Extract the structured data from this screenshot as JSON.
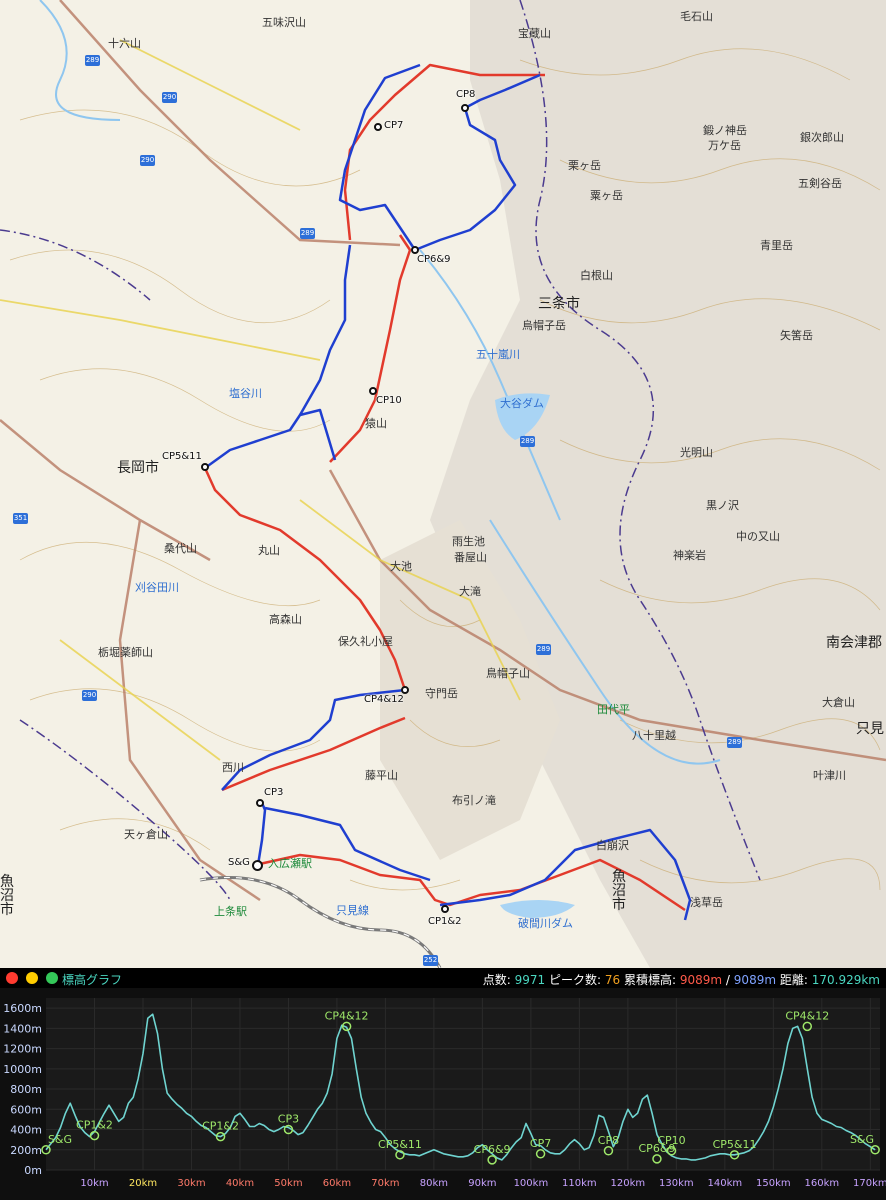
{
  "map": {
    "cities": [
      "三条市",
      "長岡市",
      "魚沼市",
      "南会津郡",
      "只見"
    ],
    "mountains": [
      "五味沢山",
      "粟ヶ岳",
      "宝蔵山",
      "毛石山",
      "銀次郎山",
      "五剣谷岳",
      "青里岳",
      "白根山",
      "烏帽子岳",
      "光明山",
      "矢筈岳",
      "猿山",
      "丸山",
      "守門岳",
      "鳥帽子山",
      "大倉山",
      "中の又山",
      "桑代山",
      "刈谷田川",
      "高森山",
      "栃堀薬師山",
      "西川",
      "天ヶ倉山",
      "藤平山",
      "布引ノ滝",
      "白崩沢",
      "浅草岳",
      "神楽岩",
      "叶津川",
      "鍛ノ神岳",
      "万ケ岳",
      "田代平",
      "八十里越",
      "五十嵐川",
      "栗ヶ岳",
      "黒ノ沢",
      "大池",
      "雨生池",
      "番屋山",
      "大滝",
      "保久礼小屋",
      "十六山",
      "塩谷川"
    ],
    "water": [
      "大谷ダム",
      "破間川ダム",
      "只見線"
    ],
    "stations": [
      "上条駅",
      "入広瀬駅"
    ],
    "road_numbers": [
      "289",
      "290",
      "351",
      "252"
    ],
    "checkpoints": [
      "CP8",
      "CP7",
      "CP6&9",
      "CP10",
      "CP5&11",
      "CP4&12",
      "CP3",
      "S&G",
      "CP1&2"
    ]
  },
  "graph": {
    "title": "標高グラフ",
    "stats": {
      "points_label": "点数:",
      "points": "9971",
      "peaks_label": "ピーク数:",
      "peaks": "76",
      "gain_label": "累積標高:",
      "gain_up": "9089m",
      "separator": "/",
      "gain_down": "9089m",
      "distance_label": "距離:",
      "distance": "170.929km"
    }
  },
  "chart_data": {
    "type": "line",
    "title": "標高グラフ",
    "xlim": [
      0,
      172
    ],
    "ylim": [
      0,
      1700
    ],
    "x_ticks": [
      "10km",
      "20km",
      "30km",
      "40km",
      "50km",
      "60km",
      "70km",
      "80km",
      "90km",
      "100km",
      "110km",
      "120km",
      "130km",
      "140km",
      "150km",
      "160km",
      "170km"
    ],
    "y_ticks": [
      "0m",
      "200m",
      "400m",
      "600m",
      "800m",
      "1000m",
      "1200m",
      "1400m",
      "1600m"
    ],
    "series": [
      {
        "x": [
          0,
          1,
          2,
          3,
          4,
          5,
          6,
          7,
          8,
          9,
          10,
          11,
          12,
          13,
          14,
          15,
          16,
          17,
          18,
          19,
          20,
          21,
          22,
          23,
          24,
          25,
          26,
          27,
          28,
          29,
          30,
          31,
          32,
          33,
          34,
          35,
          36,
          37,
          38,
          39,
          40,
          41,
          42,
          43,
          44,
          45,
          46,
          47,
          48,
          49,
          50,
          51,
          52,
          53,
          54,
          55,
          56,
          57,
          58,
          59,
          60,
          61,
          62,
          63,
          64,
          65,
          66,
          67,
          68,
          69,
          70,
          71,
          72,
          73,
          74,
          75,
          76,
          77,
          78,
          79,
          80,
          81,
          82,
          83,
          84,
          85,
          86,
          87,
          88,
          89,
          90,
          91,
          92,
          93,
          94,
          95,
          96,
          97,
          98,
          99,
          100,
          101,
          102,
          103,
          104,
          105,
          106,
          107,
          108,
          109,
          110,
          111,
          112,
          113,
          114,
          115,
          116,
          117,
          118,
          119,
          120,
          121,
          122,
          123,
          124,
          125,
          126,
          127,
          128,
          129,
          130,
          131,
          132,
          133,
          134,
          135,
          136,
          137,
          138,
          139,
          140,
          141,
          142,
          143,
          144,
          145,
          146,
          147,
          148,
          149,
          150,
          151,
          152,
          153,
          154,
          155,
          156,
          157,
          158,
          159,
          160,
          161,
          162,
          163,
          164,
          165,
          166,
          167,
          168,
          169,
          170,
          171
        ],
        "y": [
          200,
          260,
          320,
          420,
          560,
          660,
          540,
          430,
          370,
          330,
          380,
          470,
          560,
          640,
          560,
          480,
          520,
          660,
          720,
          900,
          1150,
          1500,
          1540,
          1350,
          1000,
          760,
          700,
          650,
          610,
          560,
          530,
          480,
          440,
          420,
          380,
          340,
          330,
          360,
          420,
          530,
          560,
          500,
          430,
          430,
          460,
          440,
          400,
          380,
          400,
          430,
          420,
          390,
          350,
          370,
          440,
          520,
          600,
          660,
          760,
          950,
          1300,
          1430,
          1410,
          1300,
          1000,
          720,
          560,
          470,
          400,
          380,
          320,
          250,
          210,
          180,
          160,
          150,
          150,
          140,
          160,
          180,
          200,
          180,
          160,
          150,
          140,
          130,
          130,
          140,
          170,
          220,
          250,
          200,
          160,
          120,
          100,
          150,
          220,
          280,
          320,
          460,
          360,
          250,
          240,
          200,
          170,
          160,
          160,
          200,
          260,
          300,
          260,
          200,
          220,
          340,
          540,
          520,
          380,
          230,
          320,
          480,
          600,
          520,
          560,
          700,
          740,
          560,
          350,
          260,
          180,
          140,
          120,
          110,
          110,
          100,
          100,
          110,
          120,
          140,
          150,
          160,
          160,
          150,
          150,
          160,
          170,
          190,
          230,
          300,
          380,
          480,
          620,
          800,
          1000,
          1250,
          1400,
          1420,
          1300,
          1000,
          720,
          560,
          500,
          480,
          460,
          430,
          420,
          390,
          370,
          340,
          300,
          260,
          230,
          200
        ]
      }
    ],
    "annotations": [
      {
        "label": "S&G",
        "x": 0,
        "y": 200
      },
      {
        "label": "CP1&2",
        "x": 10,
        "y": 340
      },
      {
        "label": "CP1&2",
        "x": 36,
        "y": 330
      },
      {
        "label": "CP3",
        "x": 50,
        "y": 400
      },
      {
        "label": "CP4&12",
        "x": 62,
        "y": 1420
      },
      {
        "label": "CP5&11",
        "x": 73,
        "y": 150
      },
      {
        "label": "CP6&9",
        "x": 92,
        "y": 100
      },
      {
        "label": "CP7",
        "x": 102,
        "y": 160
      },
      {
        "label": "CP8",
        "x": 116,
        "y": 190
      },
      {
        "label": "CP6&9",
        "x": 126,
        "y": 110
      },
      {
        "label": "CP10",
        "x": 129,
        "y": 190
      },
      {
        "label": "CP5&11",
        "x": 142,
        "y": 150
      },
      {
        "label": "CP4&12",
        "x": 157,
        "y": 1420
      },
      {
        "label": "S&G",
        "x": 171,
        "y": 200
      }
    ],
    "colors": {
      "line": "#6fd4d0",
      "marker": "#9fe86a",
      "grid": "#2a2a2a",
      "x_tick_a": "#ffe760",
      "x_tick_b": "#ff7a6a",
      "x_tick_c": "#c7a2ff",
      "y_tick": "#c9d8ff"
    }
  }
}
